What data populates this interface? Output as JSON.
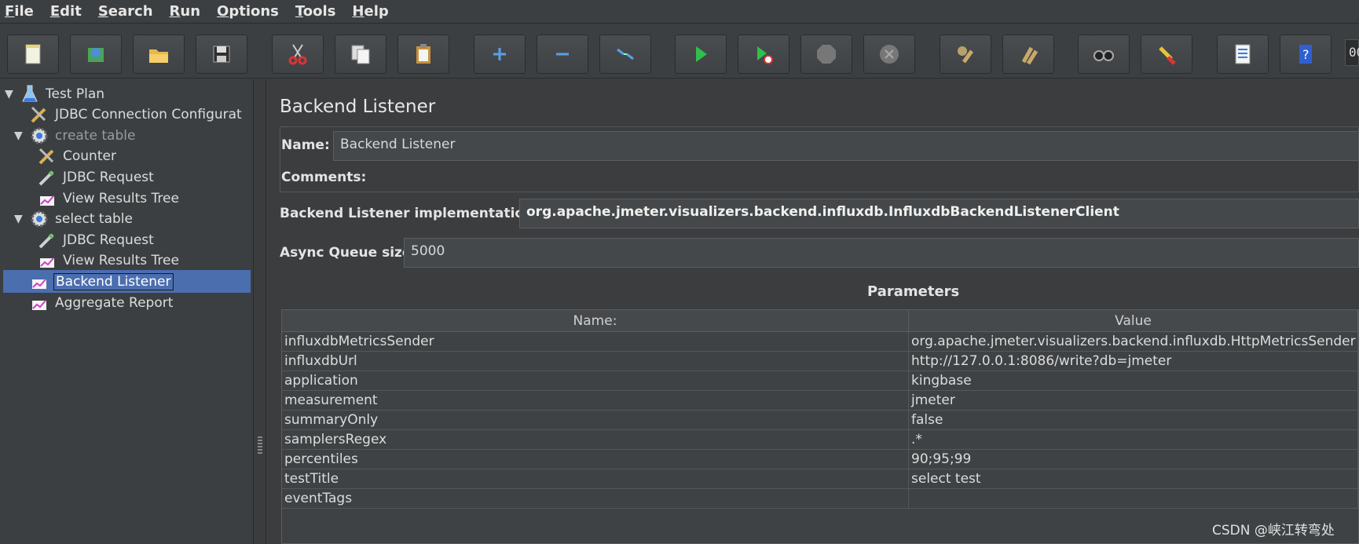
{
  "menu": [
    "File",
    "Edit",
    "Search",
    "Run",
    "Options",
    "Tools",
    "Help"
  ],
  "toolbar": {
    "buttons": [
      "new-icon",
      "templates-icon",
      "open-icon",
      "save-icon",
      "cut-icon",
      "copy-icon",
      "paste-icon",
      "expand-icon",
      "collapse-icon",
      "toggle-icon",
      "start-icon",
      "start-no-pauses-icon",
      "stop-icon",
      "shutdown-icon",
      "clear-icon",
      "clear-all-icon",
      "search-icon",
      "reset-search-icon",
      "function-helper-icon",
      "help-icon"
    ],
    "edge_text": "00"
  },
  "tree": {
    "items": [
      {
        "label": "Test Plan",
        "icon": "flask-icon",
        "level": 0,
        "expanded": true,
        "disabled": false
      },
      {
        "label": "JDBC Connection Configurat",
        "icon": "config-tools-icon",
        "level": 1,
        "disabled": false
      },
      {
        "label": "create table",
        "icon": "thread-group-icon",
        "level": 1,
        "expanded": true,
        "disabled": true
      },
      {
        "label": "Counter",
        "icon": "config-tools-icon",
        "level": 2,
        "disabled": false
      },
      {
        "label": "JDBC Request",
        "icon": "sampler-icon",
        "level": 2,
        "disabled": false
      },
      {
        "label": "View Results Tree",
        "icon": "listener-icon",
        "level": 2,
        "disabled": false
      },
      {
        "label": "select table",
        "icon": "thread-group-icon",
        "level": 1,
        "expanded": true,
        "disabled": false
      },
      {
        "label": "JDBC Request",
        "icon": "sampler-icon",
        "level": 2,
        "disabled": false
      },
      {
        "label": "View Results Tree",
        "icon": "listener-icon",
        "level": 2,
        "disabled": false
      },
      {
        "label": "Backend Listener",
        "icon": "listener-icon",
        "level": 1,
        "selected": true
      },
      {
        "label": "Aggregate Report",
        "icon": "listener-icon",
        "level": 1,
        "disabled": false
      }
    ]
  },
  "panel": {
    "title": "Backend Listener",
    "name_label": "Name:",
    "name_value": "Backend Listener",
    "comments_label": "Comments:",
    "impl_label": "Backend Listener implementation",
    "impl_value": "org.apache.jmeter.visualizers.backend.influxdb.InfluxdbBackendListenerClient",
    "queue_label": "Async Queue size",
    "queue_value": "5000",
    "params_title": "Parameters",
    "table": {
      "headers": [
        "Name:",
        "Value"
      ],
      "rows": [
        [
          "influxdbMetricsSender",
          "org.apache.jmeter.visualizers.backend.influxdb.HttpMetricsSender"
        ],
        [
          "influxdbUrl",
          "http://127.0.0.1:8086/write?db=jmeter"
        ],
        [
          "application",
          "kingbase"
        ],
        [
          "measurement",
          "jmeter"
        ],
        [
          "summaryOnly",
          "false"
        ],
        [
          "samplersRegex",
          ".*"
        ],
        [
          "percentiles",
          "90;95;99"
        ],
        [
          "testTitle",
          "select test"
        ],
        [
          "eventTags",
          ""
        ]
      ]
    }
  },
  "watermark": "CSDN @峡江转弯处",
  "colors": {
    "selection": "#4b6eaf",
    "background": "#3b3d3f"
  }
}
